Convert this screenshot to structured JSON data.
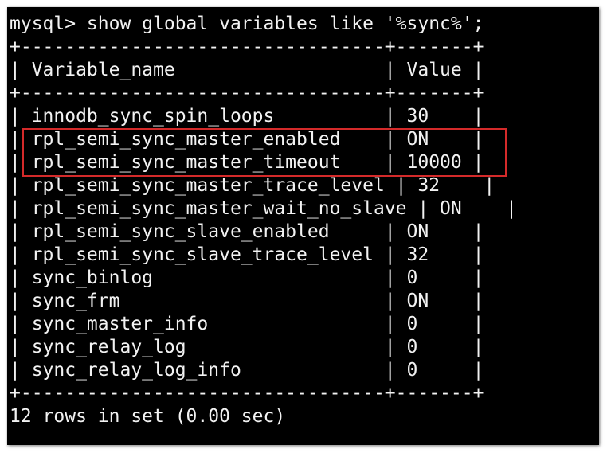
{
  "command_line": "mysql> show global variables like '%sync%';",
  "border_line": "+---------------------------------+-------+",
  "header_row": "| Variable_name                   | Value |",
  "rows": [
    "| innodb_sync_spin_loops          | 30    |",
    "| rpl_semi_sync_master_enabled    | ON    |",
    "| rpl_semi_sync_master_timeout    | 10000 |",
    "| rpl_semi_sync_master_trace_level | 32    |",
    "| rpl_semi_sync_master_wait_no_slave | ON    |",
    "| rpl_semi_sync_slave_enabled     | ON    |",
    "| rpl_semi_sync_slave_trace_level | 32    |",
    "| sync_binlog                     | 0     |",
    "| sync_frm                        | ON    |",
    "| sync_master_info                | 0     |",
    "| sync_relay_log                  | 0     |",
    "| sync_relay_log_info             | 0     |"
  ],
  "result_summary": "12 rows in set (0.00 sec)",
  "colors": {
    "terminal_background": "#000000",
    "terminal_text": "#f2f2f2",
    "highlight_border": "#d42a2a"
  }
}
